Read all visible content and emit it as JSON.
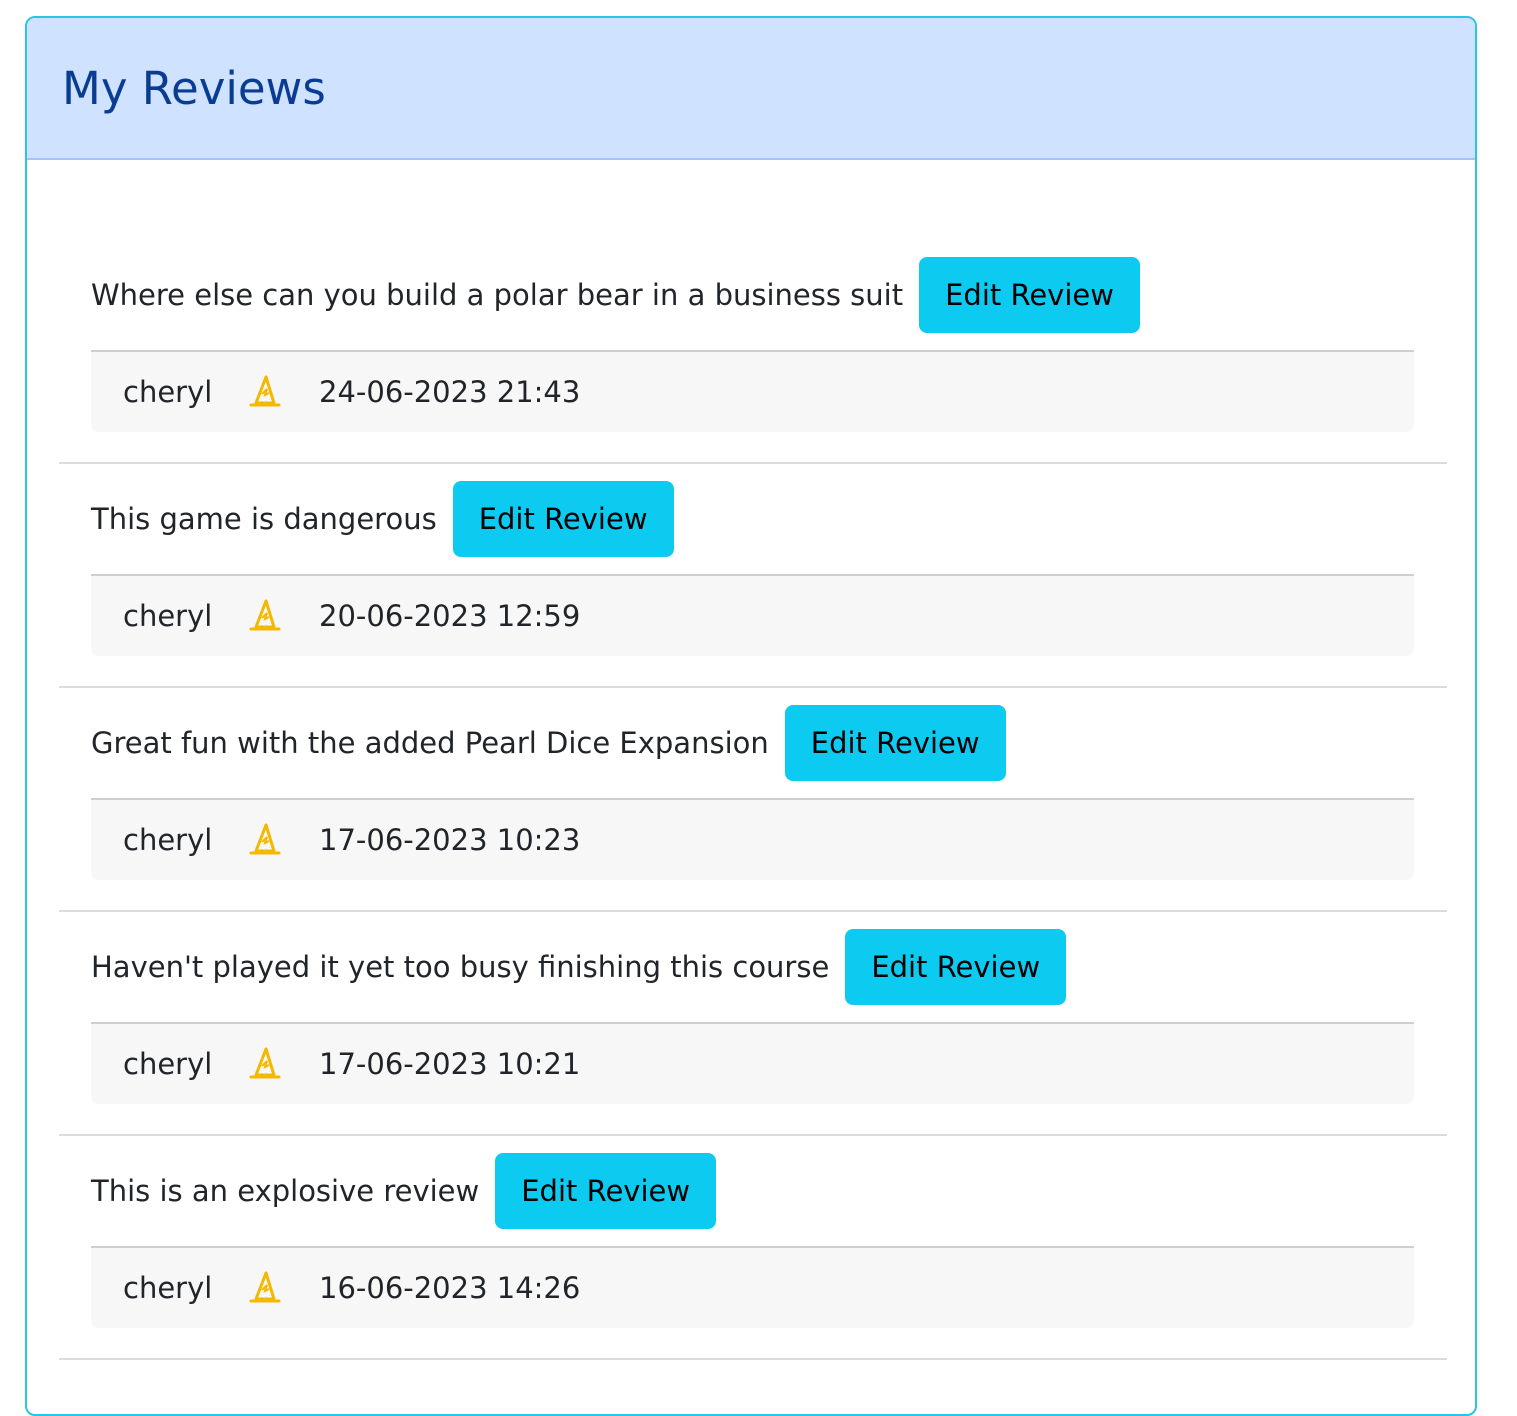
{
  "header": {
    "title": "My Reviews"
  },
  "colors": {
    "header_bg": "#cfe2ff",
    "header_text": "#0a3d91",
    "button_bg": "#0dcaf0",
    "card_border": "#2bc3e6",
    "icon": "#f5b800"
  },
  "reviews": [
    {
      "text": "Where else can you build a polar bear in a business suit",
      "button_label": "Edit Review",
      "user": "cheryl",
      "icon": "wizard-hat-icon",
      "date": "24-06-2023 21:43"
    },
    {
      "text": "This game is dangerous",
      "button_label": "Edit Review",
      "user": "cheryl",
      "icon": "wizard-hat-icon",
      "date": "20-06-2023 12:59"
    },
    {
      "text": "Great fun with the added Pearl Dice Expansion",
      "button_label": "Edit Review",
      "user": "cheryl",
      "icon": "wizard-hat-icon",
      "date": "17-06-2023 10:23"
    },
    {
      "text": "Haven't played it yet too busy finishing this course",
      "button_label": "Edit Review",
      "user": "cheryl",
      "icon": "wizard-hat-icon",
      "date": "17-06-2023 10:21"
    },
    {
      "text": "This is an explosive review",
      "button_label": "Edit Review",
      "user": "cheryl",
      "icon": "wizard-hat-icon",
      "date": "16-06-2023 14:26"
    }
  ]
}
